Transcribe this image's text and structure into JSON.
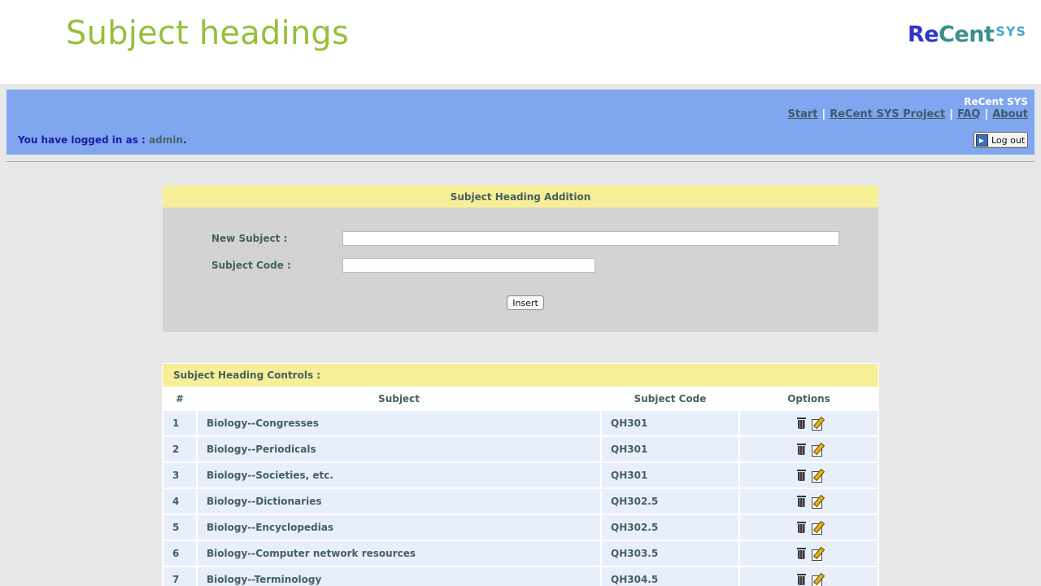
{
  "slide": {
    "title": "Subject headings",
    "logo": {
      "part1": "Re",
      "part2": "Cent",
      "part3": "SYS"
    }
  },
  "topbar": {
    "brand": "ReCent SYS",
    "nav": [
      {
        "label": "Start"
      },
      {
        "label": "ReCent SYS Project"
      },
      {
        "label": "FAQ"
      },
      {
        "label": "About"
      }
    ],
    "nav_separator": "|",
    "login_prefix": "You have logged in as :",
    "login_user": "admin",
    "logout_label": "Log out"
  },
  "addition": {
    "title": "Subject Heading Addition",
    "new_subject_label": "New Subject :",
    "new_subject_value": "",
    "subject_code_label": "Subject Code :",
    "subject_code_value": "",
    "insert_label": "Insert"
  },
  "controls": {
    "title": "Subject Heading Controls :",
    "columns": [
      "#",
      "Subject",
      "Subject Code",
      "Options"
    ],
    "rows": [
      {
        "num": "1",
        "subject": "Biology--Congresses",
        "code": "QH301"
      },
      {
        "num": "2",
        "subject": "Biology--Periodicals",
        "code": "QH301"
      },
      {
        "num": "3",
        "subject": "Biology--Societies, etc.",
        "code": "QH301"
      },
      {
        "num": "4",
        "subject": "Biology--Dictionaries",
        "code": "QH302.5"
      },
      {
        "num": "5",
        "subject": "Biology--Encyclopedias",
        "code": "QH302.5"
      },
      {
        "num": "6",
        "subject": "Biology--Computer network resources",
        "code": "QH303.5"
      },
      {
        "num": "7",
        "subject": "Biology--Terminology",
        "code": "QH304.5"
      }
    ]
  },
  "colors": {
    "title_green": "#94c03a",
    "topbar_blue": "#7fa6ef",
    "panel_yellow": "#f7ee98",
    "row_blue": "#e8effb"
  }
}
